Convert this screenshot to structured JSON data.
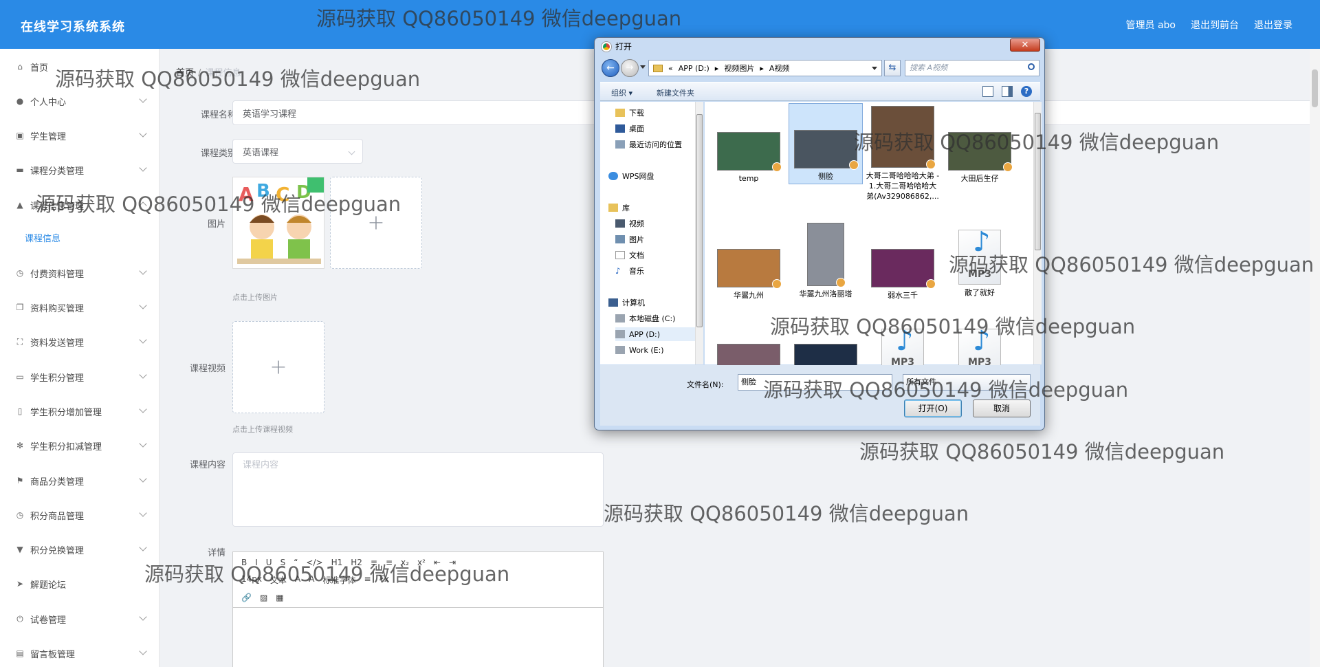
{
  "header": {
    "title": "在线学习系统系统",
    "user": "管理员 abo",
    "to_front": "退出到前台",
    "logout": "退出登录"
  },
  "sidebar": {
    "items": [
      {
        "label": "首页",
        "icon": "home-icon"
      },
      {
        "label": "个人中心",
        "icon": "user-icon"
      },
      {
        "label": "学生管理",
        "icon": "clipboard-icon"
      },
      {
        "label": "课程分类管理",
        "icon": "chat-icon"
      },
      {
        "label": "课程信息管理",
        "icon": "thumb-icon"
      },
      {
        "label": "课程信息",
        "icon": ""
      },
      {
        "label": "付费资料管理",
        "icon": "clock-icon"
      },
      {
        "label": "资料购买管理",
        "icon": "copy-icon"
      },
      {
        "label": "资料发送管理",
        "icon": "fullscreen-icon"
      },
      {
        "label": "学生积分管理",
        "icon": "card-icon"
      },
      {
        "label": "学生积分增加管理",
        "icon": "phone-icon"
      },
      {
        "label": "学生积分扣减管理",
        "icon": "compass-icon"
      },
      {
        "label": "商品分类管理",
        "icon": "flag-icon"
      },
      {
        "label": "积分商品管理",
        "icon": "clock-icon"
      },
      {
        "label": "积分兑换管理",
        "icon": "stamp-icon"
      },
      {
        "label": "解题论坛",
        "icon": "send-icon"
      },
      {
        "label": "试卷管理",
        "icon": "power-icon"
      },
      {
        "label": "留言板管理",
        "icon": "board-icon"
      }
    ]
  },
  "breadcrumb": {
    "home": "首页",
    "sep": "/",
    "current": "课程信息"
  },
  "form": {
    "name_label": "课程名称",
    "name_value": "英语学习课程",
    "category_label": "课程类别",
    "category_value": "英语课程",
    "image_label": "图片",
    "image_hint": "点击上传图片",
    "video_label": "课程视频",
    "video_hint": "点击上传课程视频",
    "content_label": "课程内容",
    "content_placeholder": "课程内容",
    "detail_label": "详情",
    "editor_row1": [
      "B",
      "I",
      "U",
      "S",
      "“",
      "</>",
      "H1",
      "H2",
      "≡",
      "≡",
      "x₂",
      "x²",
      "⇤",
      "⇥"
    ],
    "editor_row2": [
      "14px",
      "文本",
      "A",
      "A",
      "标准字体",
      "≡",
      "Tx"
    ],
    "editor_row3": [
      "link-icon",
      "image-icon",
      "video-icon"
    ]
  },
  "dialog": {
    "title": "打开",
    "path": [
      "«",
      "APP (D:)",
      "▸",
      "视频图片",
      "▸",
      "A视频"
    ],
    "search_placeholder": "搜索 A视频",
    "organize": "组织 ▾",
    "new_folder": "新建文件夹",
    "tree": [
      {
        "label": "下载",
        "icon": "folder-icon"
      },
      {
        "label": "桌面",
        "icon": "desktop-icon"
      },
      {
        "label": "最近访问的位置",
        "icon": "recent-icon"
      },
      {
        "label": "WPS网盘",
        "icon": "cloud-icon"
      },
      {
        "label": "库",
        "icon": "library-icon"
      },
      {
        "label": "视频",
        "icon": "video-icon"
      },
      {
        "label": "图片",
        "icon": "picture-icon"
      },
      {
        "label": "文档",
        "icon": "document-icon"
      },
      {
        "label": "音乐",
        "icon": "music-icon"
      },
      {
        "label": "计算机",
        "icon": "computer-icon"
      },
      {
        "label": "本地磁盘 (C:)",
        "icon": "drive-icon"
      },
      {
        "label": "APP (D:)",
        "icon": "drive-icon"
      },
      {
        "label": "Work (E:)",
        "icon": "drive-icon"
      }
    ],
    "files": [
      {
        "name": "temp",
        "kind": "video",
        "color": "#3d6b4d"
      },
      {
        "name": "侧脸",
        "kind": "video",
        "color": "#4a5560"
      },
      {
        "name": "大哥二哥哈哈哈大弟 - 1.大哥二哥哈哈哈大弟(Av329086862,...",
        "kind": "video-tall",
        "color": "#6b4f3a"
      },
      {
        "name": "大田后生仔",
        "kind": "video",
        "color": "#4d5a40"
      },
      {
        "name": "华翯九州",
        "kind": "video",
        "color": "#b87a3f"
      },
      {
        "name": "华翯九州洛丽塔",
        "kind": "tall",
        "color": "#8a8f99"
      },
      {
        "name": "弱水三千",
        "kind": "video",
        "color": "#6a2a5e"
      },
      {
        "name": "散了就好",
        "kind": "mp3",
        "color": ""
      },
      {
        "name": "",
        "kind": "video",
        "color": "#7a5d6a"
      },
      {
        "name": "",
        "kind": "video",
        "color": "#1e2e46"
      },
      {
        "name": "",
        "kind": "mp3",
        "color": ""
      },
      {
        "name": "",
        "kind": "mp3",
        "color": ""
      }
    ],
    "mp3_label": "MP3",
    "filename_label": "文件名(N):",
    "filename_value": "侧脸",
    "filter_value": "所有文件",
    "open_button": "打开(O)",
    "cancel_button": "取消"
  },
  "watermark": "源码获取 QQ86050149 微信deepguan"
}
